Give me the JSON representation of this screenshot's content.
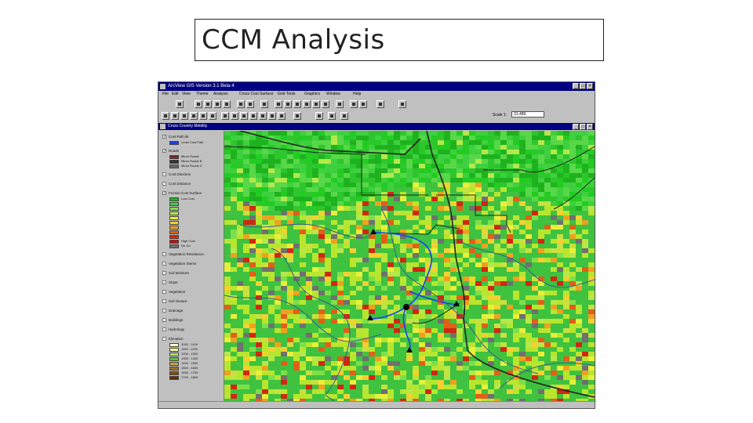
{
  "slide": {
    "title": "CCM Analysis"
  },
  "app": {
    "title": "ArcView GIS Version 3.1 Beta 4",
    "menu": [
      "File",
      "Edit",
      "View",
      "Theme",
      "Analysis",
      "Cross Cost Surface",
      "Grid Tools",
      "Graphics",
      "Window",
      "Help"
    ],
    "window_buttons": [
      "_",
      "□",
      "×"
    ]
  },
  "toolbar": {
    "scale_label": "Scale 1:",
    "scale_value": "31,489",
    "coords": [
      "",
      ""
    ]
  },
  "view": {
    "title": "Cross Country Mobility"
  },
  "toc": {
    "themes": [
      {
        "label": "Cost Path.lkt",
        "checked": true,
        "legend": [
          {
            "label": "Least Cost Path",
            "color": "#1a3cff"
          }
        ]
      },
      {
        "label": "Roads",
        "checked": true,
        "legend": [
          {
            "label": "Minor Roads",
            "color": "#7a2a2a"
          },
          {
            "label": "Minor Roads B",
            "color": "#333333"
          },
          {
            "label": "Minor Roads C",
            "color": "#6a6a6a"
          }
        ]
      },
      {
        "label": "Cost Direction",
        "checked": false,
        "legend": []
      },
      {
        "label": "Cost Distance",
        "checked": false,
        "legend": []
      },
      {
        "label": "Friction Cost Surface",
        "checked": true,
        "legend": [
          {
            "label": "Low Cost",
            "color": "#1fb21f"
          },
          {
            "label": "",
            "color": "#3fd03f"
          },
          {
            "label": "",
            "color": "#7de04a"
          },
          {
            "label": "",
            "color": "#b5e84a"
          },
          {
            "label": "",
            "color": "#e8f03a"
          },
          {
            "label": "",
            "color": "#f5d030"
          },
          {
            "label": "",
            "color": "#f0a020"
          },
          {
            "label": "",
            "color": "#e06018"
          },
          {
            "label": "",
            "color": "#d02810"
          },
          {
            "label": "High Cost",
            "color": "#c81010"
          },
          {
            "label": "No Go",
            "color": "#707070"
          }
        ]
      },
      {
        "label": "Vegetation Resistance",
        "checked": false,
        "legend": []
      },
      {
        "label": "Vegetation Stems",
        "checked": false,
        "legend": []
      },
      {
        "label": "Soil Moisture",
        "checked": false,
        "legend": []
      },
      {
        "label": "Slope",
        "checked": false,
        "legend": []
      },
      {
        "label": "Vegetation",
        "checked": false,
        "legend": []
      },
      {
        "label": "Soil Texture",
        "checked": false,
        "legend": []
      },
      {
        "label": "Drainage",
        "checked": false,
        "legend": []
      },
      {
        "label": "Buildings",
        "checked": false,
        "legend": []
      },
      {
        "label": "Hydrology",
        "checked": false,
        "legend": []
      },
      {
        "label": "Elevation",
        "checked": false,
        "legend": [
          {
            "label": "1000 - 1100",
            "color": "#ffffd0"
          },
          {
            "label": "1100 - 1200",
            "color": "#f0f0a0"
          },
          {
            "label": "1200 - 1300",
            "color": "#a8e070"
          },
          {
            "label": "1300 - 1400",
            "color": "#60c040"
          },
          {
            "label": "1400 - 1500",
            "color": "#c8a040"
          },
          {
            "label": "1500 - 1600",
            "color": "#a07020"
          },
          {
            "label": "1600 - 1700",
            "color": "#805010"
          },
          {
            "label": "1700 - 1800",
            "color": "#603008"
          }
        ]
      }
    ]
  },
  "map": {
    "base_color": "#3fc23f",
    "north_color": "#22cc22",
    "south_color": "#b8e62e",
    "road_color": "#222222",
    "river_color": "#3a5a8a",
    "path_color": "#1a3cff"
  }
}
